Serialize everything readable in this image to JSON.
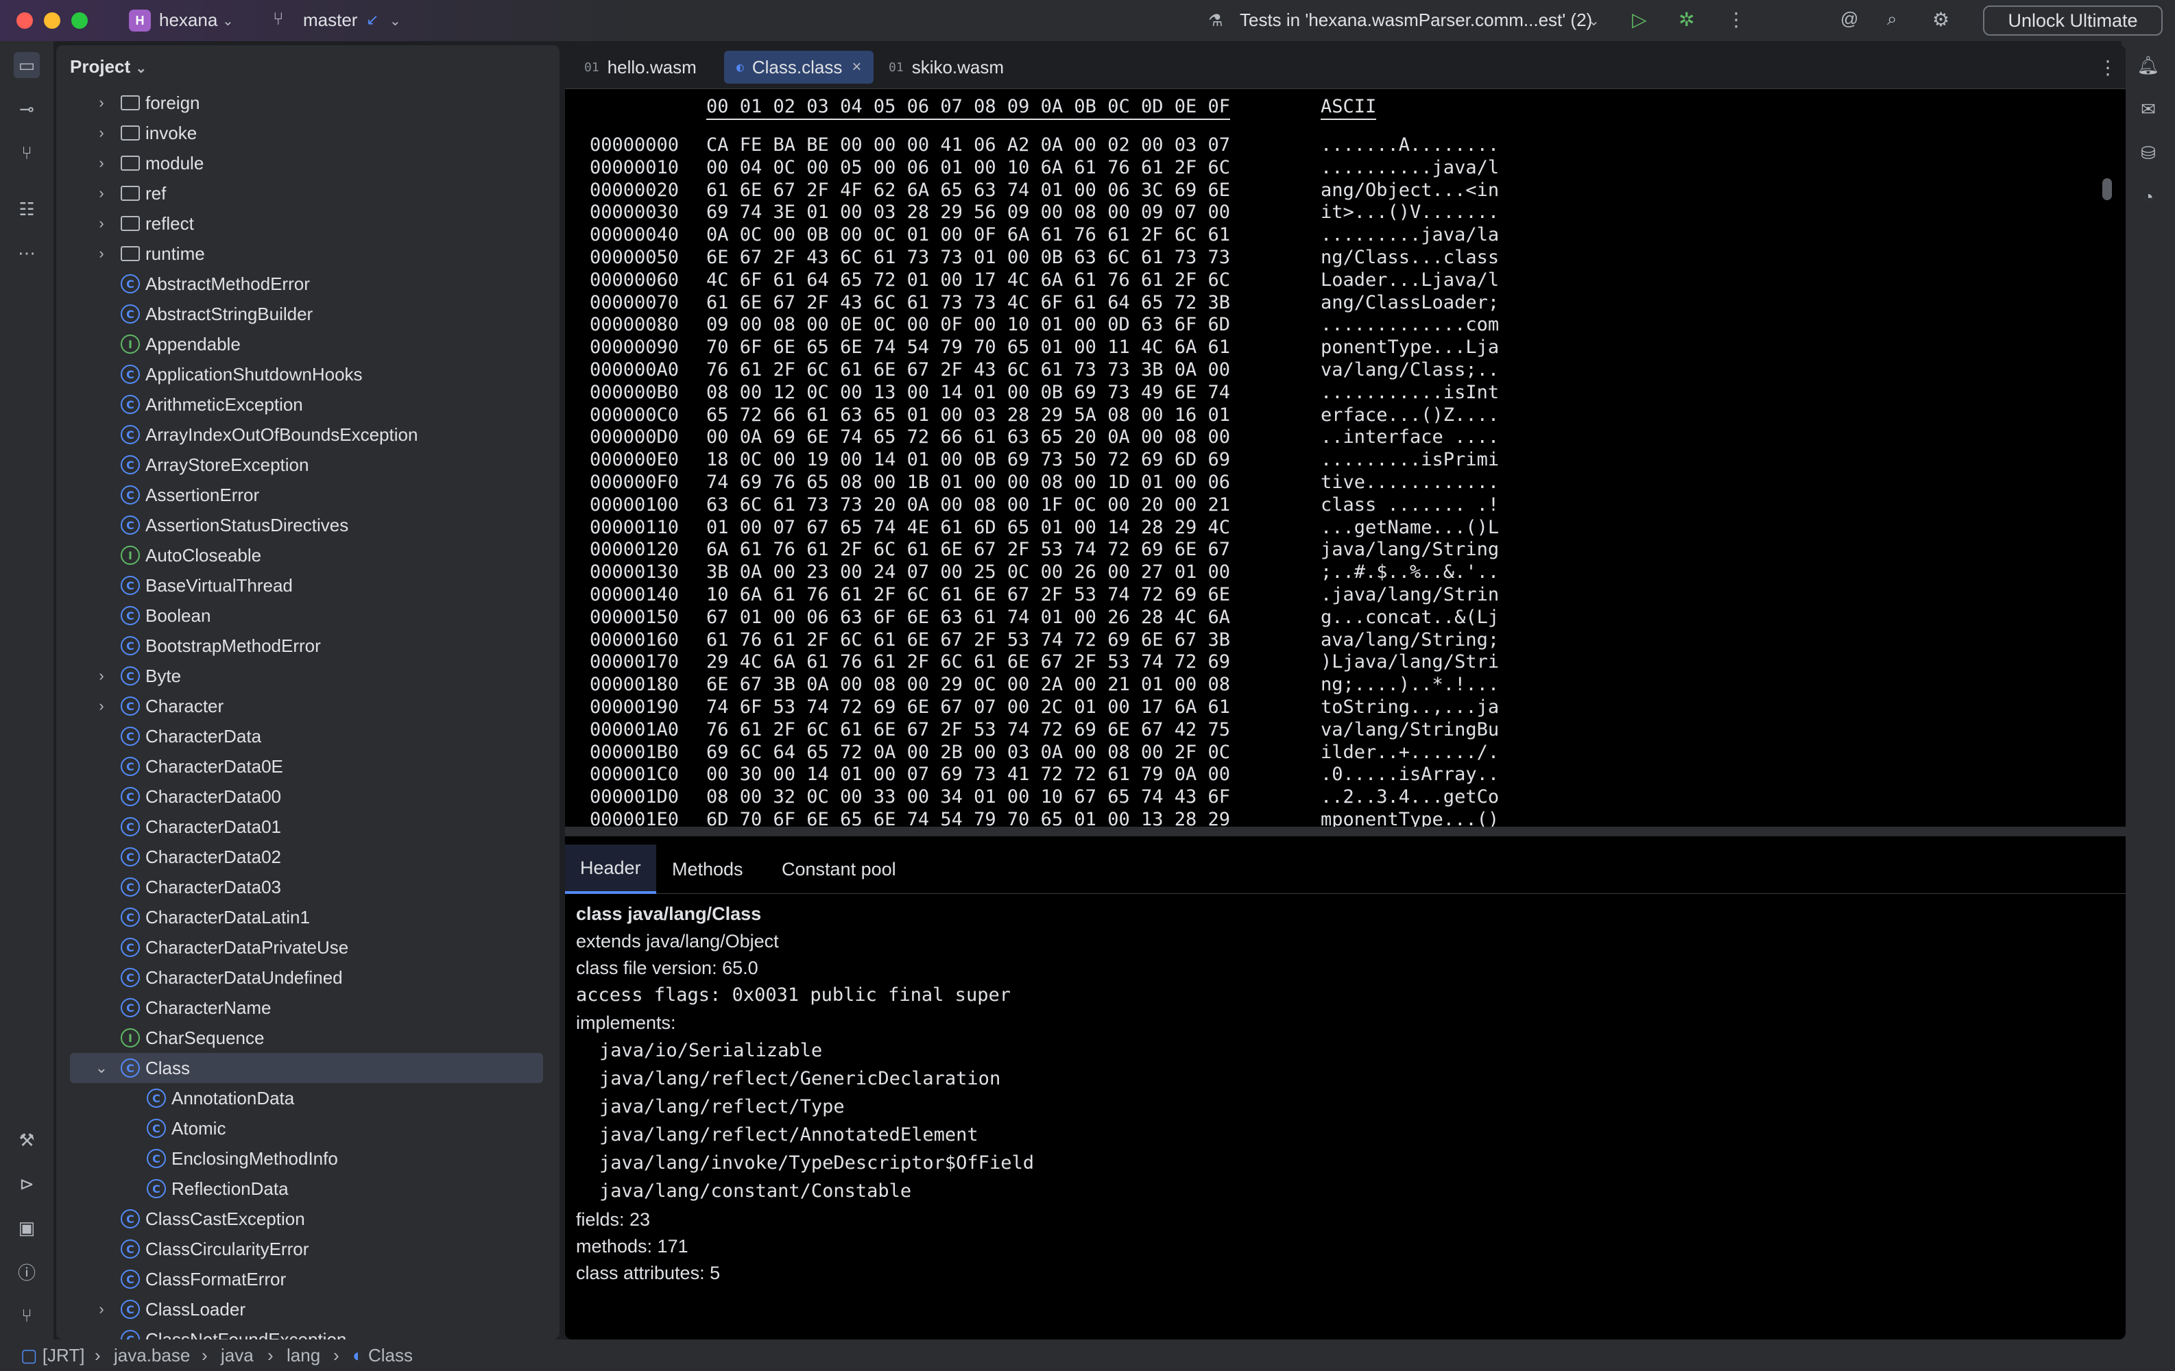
{
  "titlebar": {
    "project": "hexana",
    "project_initial": "H",
    "branch": "master",
    "run_config": "Tests in 'hexana.wasmParser.comm...est' (2)",
    "unlock": "Unlock Ultimate"
  },
  "project_panel": {
    "title": "Project",
    "items": [
      {
        "label": "foreign",
        "kind": "folder",
        "expand": "collapsed",
        "indent": 0
      },
      {
        "label": "invoke",
        "kind": "folder",
        "expand": "collapsed",
        "indent": 0
      },
      {
        "label": "module",
        "kind": "folder",
        "expand": "collapsed",
        "indent": 0
      },
      {
        "label": "ref",
        "kind": "folder",
        "expand": "collapsed",
        "indent": 0
      },
      {
        "label": "reflect",
        "kind": "folder",
        "expand": "collapsed",
        "indent": 0
      },
      {
        "label": "runtime",
        "kind": "folder",
        "expand": "collapsed",
        "indent": 0
      },
      {
        "label": "AbstractMethodError",
        "kind": "class",
        "indent": 0
      },
      {
        "label": "AbstractStringBuilder",
        "kind": "class",
        "indent": 0
      },
      {
        "label": "Appendable",
        "kind": "interface",
        "indent": 0
      },
      {
        "label": "ApplicationShutdownHooks",
        "kind": "class",
        "indent": 0
      },
      {
        "label": "ArithmeticException",
        "kind": "class",
        "indent": 0
      },
      {
        "label": "ArrayIndexOutOfBoundsException",
        "kind": "class",
        "indent": 0
      },
      {
        "label": "ArrayStoreException",
        "kind": "class",
        "indent": 0
      },
      {
        "label": "AssertionError",
        "kind": "class",
        "indent": 0
      },
      {
        "label": "AssertionStatusDirectives",
        "kind": "class",
        "indent": 0
      },
      {
        "label": "AutoCloseable",
        "kind": "interface",
        "indent": 0
      },
      {
        "label": "BaseVirtualThread",
        "kind": "class",
        "indent": 0
      },
      {
        "label": "Boolean",
        "kind": "class",
        "indent": 0
      },
      {
        "label": "BootstrapMethodError",
        "kind": "class",
        "indent": 0
      },
      {
        "label": "Byte",
        "kind": "class",
        "expand": "collapsed",
        "indent": 0
      },
      {
        "label": "Character",
        "kind": "class",
        "expand": "collapsed",
        "indent": 0
      },
      {
        "label": "CharacterData",
        "kind": "class",
        "indent": 0
      },
      {
        "label": "CharacterData0E",
        "kind": "class",
        "indent": 0
      },
      {
        "label": "CharacterData00",
        "kind": "class",
        "indent": 0
      },
      {
        "label": "CharacterData01",
        "kind": "class",
        "indent": 0
      },
      {
        "label": "CharacterData02",
        "kind": "class",
        "indent": 0
      },
      {
        "label": "CharacterData03",
        "kind": "class",
        "indent": 0
      },
      {
        "label": "CharacterDataLatin1",
        "kind": "class",
        "indent": 0
      },
      {
        "label": "CharacterDataPrivateUse",
        "kind": "class",
        "indent": 0
      },
      {
        "label": "CharacterDataUndefined",
        "kind": "class",
        "indent": 0
      },
      {
        "label": "CharacterName",
        "kind": "class",
        "indent": 0
      },
      {
        "label": "CharSequence",
        "kind": "interface",
        "indent": 0
      },
      {
        "label": "Class",
        "kind": "class",
        "expand": "expanded",
        "indent": 0,
        "selected": true
      },
      {
        "label": "AnnotationData",
        "kind": "class",
        "indent": 1
      },
      {
        "label": "Atomic",
        "kind": "class",
        "indent": 1
      },
      {
        "label": "EnclosingMethodInfo",
        "kind": "class",
        "indent": 1
      },
      {
        "label": "ReflectionData",
        "kind": "class",
        "indent": 1
      },
      {
        "label": "ClassCastException",
        "kind": "class",
        "indent": 0
      },
      {
        "label": "ClassCircularityError",
        "kind": "class",
        "indent": 0
      },
      {
        "label": "ClassFormatError",
        "kind": "class",
        "indent": 0
      },
      {
        "label": "ClassLoader",
        "kind": "class",
        "expand": "collapsed",
        "indent": 0
      },
      {
        "label": "ClassNotFoundException",
        "kind": "class",
        "indent": 0
      }
    ]
  },
  "editor_tabs": [
    {
      "label": "hello.wasm",
      "icon": "binary-file-icon",
      "active": false
    },
    {
      "label": "Class.class",
      "icon": "class-file-icon",
      "active": true,
      "closable": true
    },
    {
      "label": "skiko.wasm",
      "icon": "binary-file-icon",
      "active": false
    }
  ],
  "hex": {
    "header_bytes": "00 01 02 03 04 05 06 07 08 09 0A 0B 0C 0D 0E 0F",
    "header_ascii": "ASCII",
    "rows": [
      [
        "00000000",
        "CA FE BA BE 00 00 00 41 06 A2 0A 00 02 00 03 07",
        ".......A........"
      ],
      [
        "00000010",
        "00 04 0C 00 05 00 06 01 00 10 6A 61 76 61 2F 6C",
        "..........java/l"
      ],
      [
        "00000020",
        "61 6E 67 2F 4F 62 6A 65 63 74 01 00 06 3C 69 6E",
        "ang/Object...<in"
      ],
      [
        "00000030",
        "69 74 3E 01 00 03 28 29 56 09 00 08 00 09 07 00",
        "it>...()V......."
      ],
      [
        "00000040",
        "0A 0C 00 0B 00 0C 01 00 0F 6A 61 76 61 2F 6C 61",
        ".........java/la"
      ],
      [
        "00000050",
        "6E 67 2F 43 6C 61 73 73 01 00 0B 63 6C 61 73 73",
        "ng/Class...class"
      ],
      [
        "00000060",
        "4C 6F 61 64 65 72 01 00 17 4C 6A 61 76 61 2F 6C",
        "Loader...Ljava/l"
      ],
      [
        "00000070",
        "61 6E 67 2F 43 6C 61 73 73 4C 6F 61 64 65 72 3B",
        "ang/ClassLoader;"
      ],
      [
        "00000080",
        "09 00 08 00 0E 0C 00 0F 00 10 01 00 0D 63 6F 6D",
        ".............com"
      ],
      [
        "00000090",
        "70 6F 6E 65 6E 74 54 79 70 65 01 00 11 4C 6A 61",
        "ponentType...Lja"
      ],
      [
        "000000A0",
        "76 61 2F 6C 61 6E 67 2F 43 6C 61 73 73 3B 0A 00",
        "va/lang/Class;.."
      ],
      [
        "000000B0",
        "08 00 12 0C 00 13 00 14 01 00 0B 69 73 49 6E 74",
        "...........isInt"
      ],
      [
        "000000C0",
        "65 72 66 61 63 65 01 00 03 28 29 5A 08 00 16 01",
        "erface...()Z...."
      ],
      [
        "000000D0",
        "00 0A 69 6E 74 65 72 66 61 63 65 20 0A 00 08 00",
        "..interface ...."
      ],
      [
        "000000E0",
        "18 0C 00 19 00 14 01 00 0B 69 73 50 72 69 6D 69",
        ".........isPrimi"
      ],
      [
        "000000F0",
        "74 69 76 65 08 00 1B 01 00 00 08 00 1D 01 00 06",
        "tive............"
      ],
      [
        "00000100",
        "63 6C 61 73 73 20 0A 00 08 00 1F 0C 00 20 00 21",
        "class ....... .!"
      ],
      [
        "00000110",
        "01 00 07 67 65 74 4E 61 6D 65 01 00 14 28 29 4C",
        "...getName...()L"
      ],
      [
        "00000120",
        "6A 61 76 61 2F 6C 61 6E 67 2F 53 74 72 69 6E 67",
        "java/lang/String"
      ],
      [
        "00000130",
        "3B 0A 00 23 00 24 07 00 25 0C 00 26 00 27 01 00",
        ";..#.$..%..&.'.."
      ],
      [
        "00000140",
        "10 6A 61 76 61 2F 6C 61 6E 67 2F 53 74 72 69 6E",
        ".java/lang/Strin"
      ],
      [
        "00000150",
        "67 01 00 06 63 6F 6E 63 61 74 01 00 26 28 4C 6A",
        "g...concat..&(Lj"
      ],
      [
        "00000160",
        "61 76 61 2F 6C 61 6E 67 2F 53 74 72 69 6E 67 3B",
        "ava/lang/String;"
      ],
      [
        "00000170",
        "29 4C 6A 61 76 61 2F 6C 61 6E 67 2F 53 74 72 69",
        ")Ljava/lang/Stri"
      ],
      [
        "00000180",
        "6E 67 3B 0A 00 08 00 29 0C 00 2A 00 21 01 00 08",
        "ng;....)..*.!..."
      ],
      [
        "00000190",
        "74 6F 53 74 72 69 6E 67 07 00 2C 01 00 17 6A 61",
        "toString..,...ja"
      ],
      [
        "000001A0",
        "76 61 2F 6C 61 6E 67 2F 53 74 72 69 6E 67 42 75",
        "va/lang/StringBu"
      ],
      [
        "000001B0",
        "69 6C 64 65 72 0A 00 2B 00 03 0A 00 08 00 2F 0C",
        "ilder..+....../."
      ],
      [
        "000001C0",
        "00 30 00 14 01 00 07 69 73 41 72 72 61 79 0A 00",
        ".0.....isArray.."
      ],
      [
        "000001D0",
        "08 00 32 0C 00 33 00 34 01 00 10 67 65 74 43 6F",
        "..2..3.4...getCo"
      ],
      [
        "000001E0",
        "6D 70 6F 6E 65 6E 74 54 79 70 65 01 00 13 28 29",
        "mponentType...()"
      ]
    ]
  },
  "bottom_tabs": [
    "Header",
    "Methods",
    "Constant pool"
  ],
  "class_header": {
    "title": "class java/lang/Class",
    "extends": "extends java/lang/Object",
    "version": "class file version: 65.0",
    "access": "access flags: 0x0031 public final super",
    "implements_label": "implements:",
    "implements": [
      "java/io/Serializable",
      "java/lang/reflect/GenericDeclaration",
      "java/lang/reflect/Type",
      "java/lang/reflect/AnnotatedElement",
      "java/lang/invoke/TypeDescriptor$OfField",
      "java/lang/constant/Constable"
    ],
    "fields": "fields: 23",
    "methods": "methods: 171",
    "attributes": "class attributes: 5"
  },
  "statusbar": {
    "crumbs": [
      "[JRT]",
      "java.base",
      "java",
      "lang",
      "Class"
    ]
  },
  "colors": {
    "accent": "#548af7",
    "interface": "#5fb865",
    "selected_row": "#3d4250",
    "project_badge": "#a060c8"
  }
}
